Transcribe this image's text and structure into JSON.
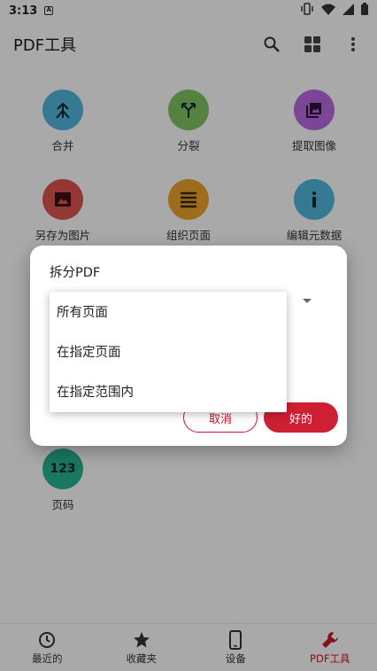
{
  "status": {
    "time": "3:13",
    "a_icon": "A"
  },
  "appbar": {
    "title": "PDF工具"
  },
  "tools": [
    {
      "label": "合并",
      "color": "#4fb3d9",
      "icon": "merge-icon"
    },
    {
      "label": "分裂",
      "color": "#7fc060",
      "icon": "split-icon"
    },
    {
      "label": "提取图像",
      "color": "#b568e0",
      "icon": "extract-images-icon"
    },
    {
      "label": "另存为图片",
      "color": "#d9534f",
      "icon": "image-icon"
    },
    {
      "label": "组织页面",
      "color": "#e8a12c",
      "icon": "organize-pages-icon"
    },
    {
      "label": "编辑元数据",
      "color": "#4fb3d9",
      "icon": "info-icon"
    },
    {
      "label": "页码",
      "color": "#26b28e",
      "icon": "page-number-icon",
      "icon_text": "123"
    }
  ],
  "dialog": {
    "title": "拆分PDF",
    "cancel": "取消",
    "ok": "好的"
  },
  "dropdown": {
    "options": [
      "所有页面",
      "在指定页面",
      "在指定范围内"
    ]
  },
  "bottomnav": [
    {
      "label": "最近的",
      "icon": "clock-icon"
    },
    {
      "label": "收藏夹",
      "icon": "star-icon"
    },
    {
      "label": "设备",
      "icon": "phone-icon"
    },
    {
      "label": "PDF工具",
      "icon": "wrench-icon",
      "active": true
    }
  ],
  "colors": {
    "accent": "#cf1f32"
  }
}
